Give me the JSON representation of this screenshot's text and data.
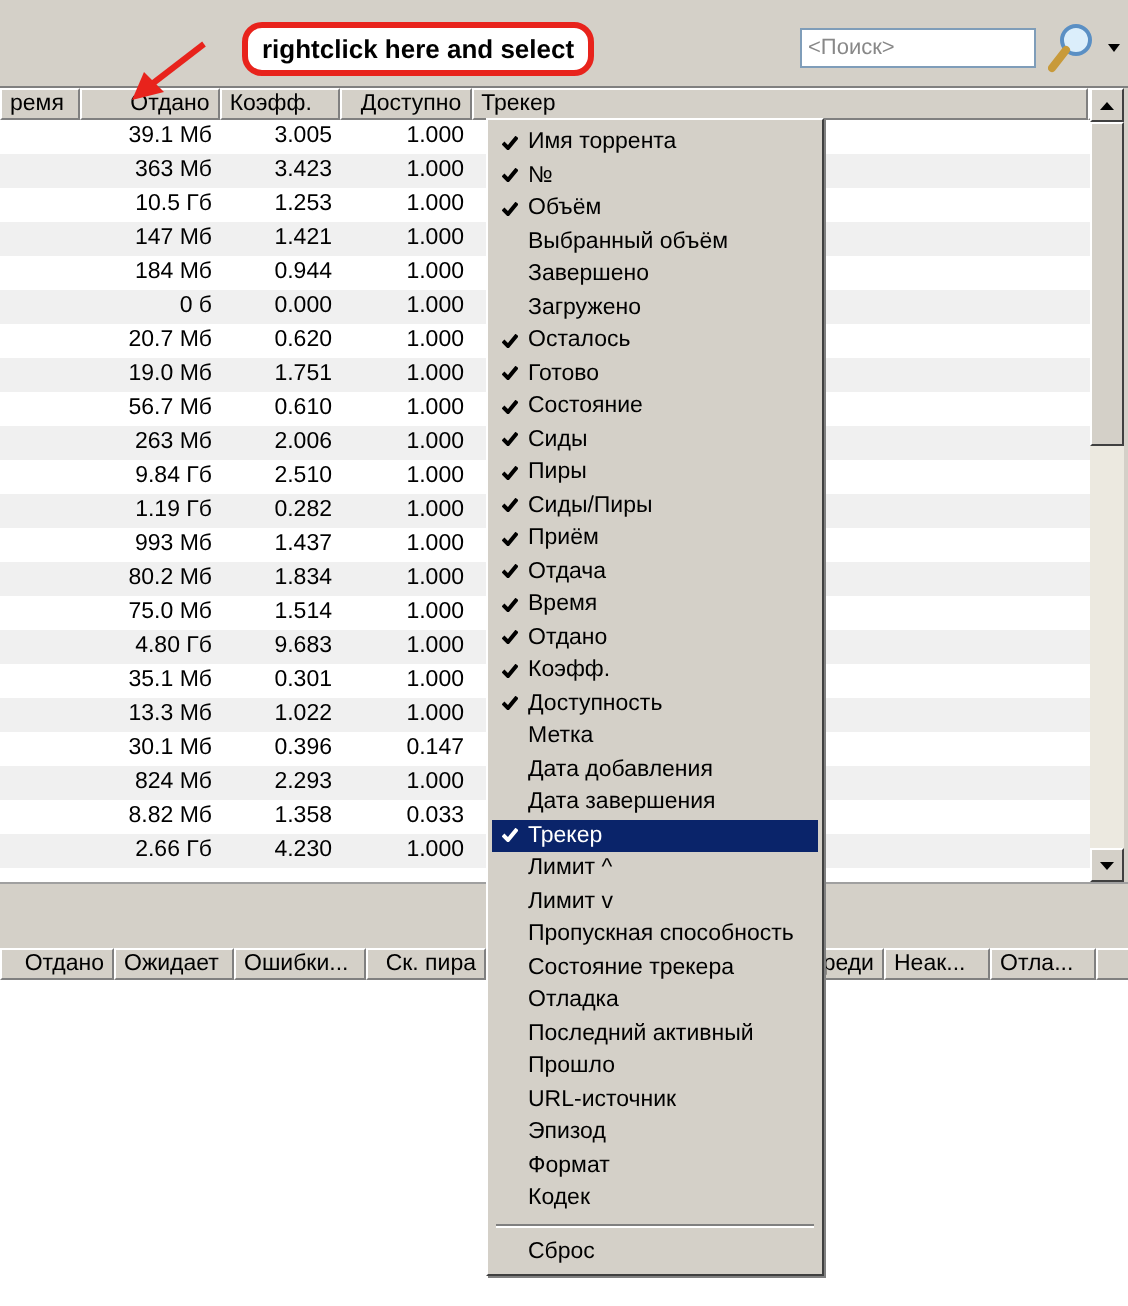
{
  "callout": {
    "text": "rightclick here and select"
  },
  "search": {
    "placeholder": "<Поиск>"
  },
  "table": {
    "columns": [
      "ремя",
      "Отдано",
      "Коэфф.",
      "Доступно",
      "Трекер"
    ],
    "rows": [
      {
        "cells": [
          "",
          "39.1 Мб",
          "3.005",
          "1.000"
        ]
      },
      {
        "cells": [
          "",
          "363 Мб",
          "3.423",
          "1.000"
        ]
      },
      {
        "cells": [
          "",
          "10.5 Гб",
          "1.253",
          "1.000"
        ]
      },
      {
        "cells": [
          "",
          "147 Мб",
          "1.421",
          "1.000"
        ]
      },
      {
        "cells": [
          "",
          "184 Мб",
          "0.944",
          "1.000"
        ]
      },
      {
        "cells": [
          "",
          "0 б",
          "0.000",
          "1.000"
        ]
      },
      {
        "cells": [
          "",
          "20.7 Мб",
          "0.620",
          "1.000"
        ]
      },
      {
        "cells": [
          "",
          "19.0 Мб",
          "1.751",
          "1.000"
        ]
      },
      {
        "cells": [
          "",
          "56.7 Мб",
          "0.610",
          "1.000"
        ]
      },
      {
        "cells": [
          "",
          "263 Мб",
          "2.006",
          "1.000"
        ]
      },
      {
        "cells": [
          "",
          "9.84 Гб",
          "2.510",
          "1.000"
        ]
      },
      {
        "cells": [
          "",
          "1.19 Гб",
          "0.282",
          "1.000"
        ]
      },
      {
        "cells": [
          "",
          "993 Мб",
          "1.437",
          "1.000"
        ]
      },
      {
        "cells": [
          "",
          "80.2 Мб",
          "1.834",
          "1.000"
        ]
      },
      {
        "cells": [
          "",
          "75.0 Мб",
          "1.514",
          "1.000"
        ]
      },
      {
        "cells": [
          "",
          "4.80 Гб",
          "9.683",
          "1.000"
        ]
      },
      {
        "cells": [
          "",
          "35.1 Мб",
          "0.301",
          "1.000"
        ]
      },
      {
        "cells": [
          "",
          "13.3 Мб",
          "1.022",
          "1.000"
        ]
      },
      {
        "cells": [
          "",
          "30.1 Мб",
          "0.396",
          "0.147"
        ]
      },
      {
        "cells": [
          "",
          "824 Мб",
          "2.293",
          "1.000"
        ]
      },
      {
        "cells": [
          "",
          "8.82 Мб",
          "1.358",
          "0.033"
        ]
      },
      {
        "cells": [
          "",
          "2.66 Гб",
          "4.230",
          "1.000"
        ]
      }
    ]
  },
  "lower_table": {
    "columns": [
      "Отдано",
      "Ожидает",
      "Ошибки...",
      "Ск. пира",
      "реди",
      "Неак...",
      "Отла..."
    ]
  },
  "context_menu": {
    "items": [
      {
        "label": "Имя торрента",
        "checked": true,
        "selected": false
      },
      {
        "label": "№",
        "checked": true,
        "selected": false
      },
      {
        "label": "Объём",
        "checked": true,
        "selected": false
      },
      {
        "label": "Выбранный объём",
        "checked": false,
        "selected": false
      },
      {
        "label": "Завершено",
        "checked": false,
        "selected": false
      },
      {
        "label": "Загружено",
        "checked": false,
        "selected": false
      },
      {
        "label": "Осталось",
        "checked": true,
        "selected": false
      },
      {
        "label": "Готово",
        "checked": true,
        "selected": false
      },
      {
        "label": "Состояние",
        "checked": true,
        "selected": false
      },
      {
        "label": "Сиды",
        "checked": true,
        "selected": false
      },
      {
        "label": "Пиры",
        "checked": true,
        "selected": false
      },
      {
        "label": "Сиды/Пиры",
        "checked": true,
        "selected": false
      },
      {
        "label": "Приём",
        "checked": true,
        "selected": false
      },
      {
        "label": "Отдача",
        "checked": true,
        "selected": false
      },
      {
        "label": "Время",
        "checked": true,
        "selected": false
      },
      {
        "label": "Отдано",
        "checked": true,
        "selected": false
      },
      {
        "label": "Коэфф.",
        "checked": true,
        "selected": false
      },
      {
        "label": "Доступность",
        "checked": true,
        "selected": false
      },
      {
        "label": "Метка",
        "checked": false,
        "selected": false
      },
      {
        "label": "Дата добавления",
        "checked": false,
        "selected": false
      },
      {
        "label": "Дата завершения",
        "checked": false,
        "selected": false
      },
      {
        "label": "Трекер",
        "checked": true,
        "selected": true
      },
      {
        "label": "Лимит ^",
        "checked": false,
        "selected": false
      },
      {
        "label": "Лимит v",
        "checked": false,
        "selected": false
      },
      {
        "label": "Пропускная способность",
        "checked": false,
        "selected": false
      },
      {
        "label": "Состояние трекера",
        "checked": false,
        "selected": false
      },
      {
        "label": "Отладка",
        "checked": false,
        "selected": false
      },
      {
        "label": "Последний активный",
        "checked": false,
        "selected": false
      },
      {
        "label": "Прошло",
        "checked": false,
        "selected": false
      },
      {
        "label": "URL-источник",
        "checked": false,
        "selected": false
      },
      {
        "label": "Эпизод",
        "checked": false,
        "selected": false
      },
      {
        "label": "Формат",
        "checked": false,
        "selected": false
      },
      {
        "label": "Кодек",
        "checked": false,
        "selected": false
      }
    ],
    "footer_item": "Сброс"
  }
}
